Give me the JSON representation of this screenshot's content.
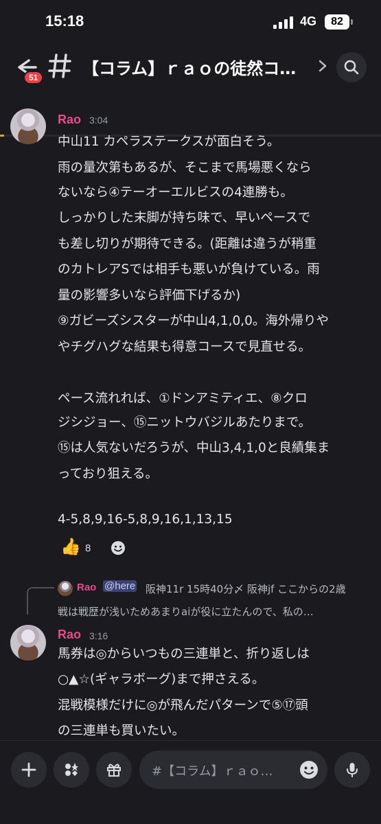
{
  "status_bar": {
    "time": "15:18",
    "network": "4G",
    "battery": "82"
  },
  "header": {
    "unread_count": "51",
    "channel_name": "【コラム】ｒａｏの徒然コ…"
  },
  "messages": [
    {
      "author": "Rao",
      "time": "3:04",
      "lines": [
        "中山11 カペラステークスが面白そう。",
        "雨の量次第もあるが、そこまで馬場悪くなら",
        "ないなら④テーオーエルビスの4連勝も。",
        "しっかりした末脚が持ち味で、早いペースで",
        "も差し切りが期待できる。(距離は違うが稍重",
        "のカトレアSでは相手も悪いが負けている。雨",
        "量の影響多いなら評価下げるか)",
        "⑨ガビーズシスターが中山4,1,0,0。海外帰りや",
        "やチグハグな結果も得意コースで見直せる。",
        "ペース流れれば、①ドンアミティエ、⑧クロ",
        "ジシジョー、⑮ニットウバジルあたりまで。",
        "⑮は人気ないだろうが、中山3,4,1,0と良績集ま",
        "っており狙える。",
        "4-5,8,9,16-5,8,9,16,1,13,15"
      ],
      "reaction": {
        "emoji": "👍",
        "count": "8"
      }
    },
    {
      "reply": {
        "author": "Rao",
        "mention": "@here",
        "preview_line1": "阪神11r 15時40分〆 阪神jf ここからの2歳",
        "preview_line2": "戦は戦歴が浅いためあまりaiが役に立たんので、私の…"
      },
      "author": "Rao",
      "time": "3:16",
      "lines": [
        "馬券は◎からいつもの三連単と、折り返しは",
        "○▲☆(ギャラボーグ)まで押さえる。",
        "混戦模様だけに◎が飛んだパターンで⑤⑰頭",
        "の三連単も買いたい。"
      ]
    }
  ],
  "composer": {
    "placeholder": "#【コラム】ｒａｏ…"
  },
  "colors": {
    "background": "#1b1b1f",
    "author": "#e94a8a",
    "badge": "#f23f43",
    "mention_bg": "#3c4270"
  },
  "icons": [
    "back-arrow-icon",
    "hash-icon",
    "chevron-right-icon",
    "search-icon",
    "plus-icon",
    "apps-icon",
    "gift-icon",
    "emoji-icon",
    "microphone-icon",
    "add-reaction-icon"
  ]
}
